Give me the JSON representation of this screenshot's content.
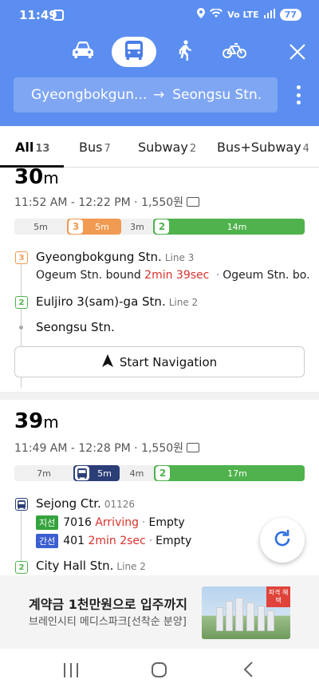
{
  "status": {
    "time": "11:49",
    "network": "Vo LTE",
    "battery": "77"
  },
  "modes": [
    {
      "name": "car-icon",
      "active": false
    },
    {
      "name": "bus-icon",
      "active": true
    },
    {
      "name": "walk-icon",
      "active": false
    },
    {
      "name": "bike-icon",
      "active": false
    }
  ],
  "route": {
    "from": "Gyeongbokgun...",
    "arrow": "→",
    "to": "Seongsu Stn."
  },
  "tabs": [
    {
      "label": "All",
      "count": "13",
      "active": true
    },
    {
      "label": "Bus",
      "count": "7"
    },
    {
      "label": "Subway",
      "count": "2"
    },
    {
      "label": "Bus+Subway",
      "count": "4"
    }
  ],
  "result1": {
    "duration_num": "30",
    "duration_unit": "m",
    "times": "11:52 AM - 12:22 PM · 1,550원",
    "bar": {
      "walk1": "5m",
      "line3_badge": "3",
      "line3_time": "5m",
      "walk2": "3m",
      "line2_badge": "2",
      "line2_time": "14m"
    },
    "stop1": {
      "badge": "3",
      "name": "Gyeongbokgung Stn.",
      "line": "Line 3"
    },
    "stop1_detail": {
      "bound": "Ogeum Stn. bound",
      "time": "2min 39sec",
      "sep": "·",
      "next": "Ogeum Stn. bo..."
    },
    "stop2": {
      "badge": "2",
      "name": "Euljiro 3(sam)-ga Stn.",
      "line": "Line 2"
    },
    "stop3": {
      "name": "Seongsu Stn."
    },
    "nav_label": "Start Navigation"
  },
  "result2": {
    "duration_num": "39",
    "duration_unit": "m",
    "times": "11:49 AM - 12:28 PM · 1,550원",
    "bar": {
      "walk1": "7m",
      "bus_time": "5m",
      "walk2": "4m",
      "line2_badge": "2",
      "line2_time": "17m"
    },
    "stop1": {
      "name": "Sejong Ctr.",
      "code": "01126"
    },
    "bus1": {
      "tag": "지선",
      "number": "7016",
      "status": "Arriving",
      "sep": "·",
      "seat": "Empty"
    },
    "bus2": {
      "tag": "간선",
      "number": "401",
      "status": "2min 2sec",
      "sep": "·",
      "seat": "Empty"
    },
    "stop2": {
      "badge": "2",
      "name": "City Hall Stn.",
      "line": "Line 2"
    }
  },
  "ad": {
    "title": "계약금 1천만원으로 입주까지",
    "subtitle": "브레인시티 메디스파크[선착순 분양]",
    "badge": "파격 혜택"
  },
  "colors": {
    "header": "#5b8ef0",
    "line3": "#f09a52",
    "line2": "#4fb24c",
    "bus": "#2c3e78",
    "highlight": "#d8322c"
  }
}
